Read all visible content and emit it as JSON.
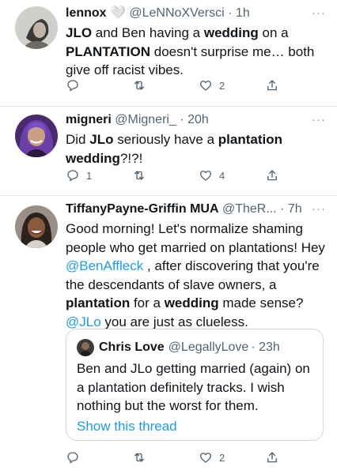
{
  "colors": {
    "link": "#1d9bf0",
    "secondary": "#536471",
    "divider": "#e6e9ec"
  },
  "tweets": [
    {
      "name": "lennox",
      "name_badge": "🤍",
      "handle": "@LeNNoXVersci",
      "time": "· 1h",
      "more": "···",
      "text": [
        {
          "b": "JLO"
        },
        {
          "t": " and Ben having a "
        },
        {
          "b": "wedding"
        },
        {
          "t": " on a "
        },
        {
          "b": "PLANTATION"
        },
        {
          "t": " doesn't surprise me… both give off racist vibes."
        }
      ],
      "stats": {
        "replies": "",
        "retweets": "",
        "likes": "2"
      }
    },
    {
      "name": "migneri",
      "handle": "@Migneri_",
      "time": "· 20h",
      "more": "···",
      "text": [
        {
          "t": "Did "
        },
        {
          "b": "JLo"
        },
        {
          "t": " seriously have a "
        },
        {
          "b": "plantation wedding"
        },
        {
          "t": "?!?!"
        }
      ],
      "stats": {
        "replies": "1",
        "retweets": "",
        "likes": "4"
      }
    },
    {
      "name": "TiffanyPayne-Griffin MUA",
      "handle": "@TheR...",
      "time": "· 7h",
      "more": "···",
      "text": [
        {
          "t": "Good morning! Let's normalize shaming people who get married on plantations! Hey "
        },
        {
          "m": "@BenAffleck"
        },
        {
          "t": " , after discovering that you're the descendants of slave owners, a "
        },
        {
          "b": "plantation"
        },
        {
          "t": " for a "
        },
        {
          "b": "wedding"
        },
        {
          "t": " made sense? "
        },
        {
          "m": "@JLo"
        },
        {
          "t": " you are just as clueless."
        }
      ],
      "quote": {
        "name": "Chris Love",
        "handle": "@LegallyLove",
        "time": "· 23h",
        "text": "Ben and JLo getting married (again) on a plantation definitely tracks. I wish nothing but the worst for them.",
        "link": "Show this thread"
      },
      "stats": {
        "replies": "",
        "retweets": "",
        "likes": "2"
      }
    }
  ]
}
